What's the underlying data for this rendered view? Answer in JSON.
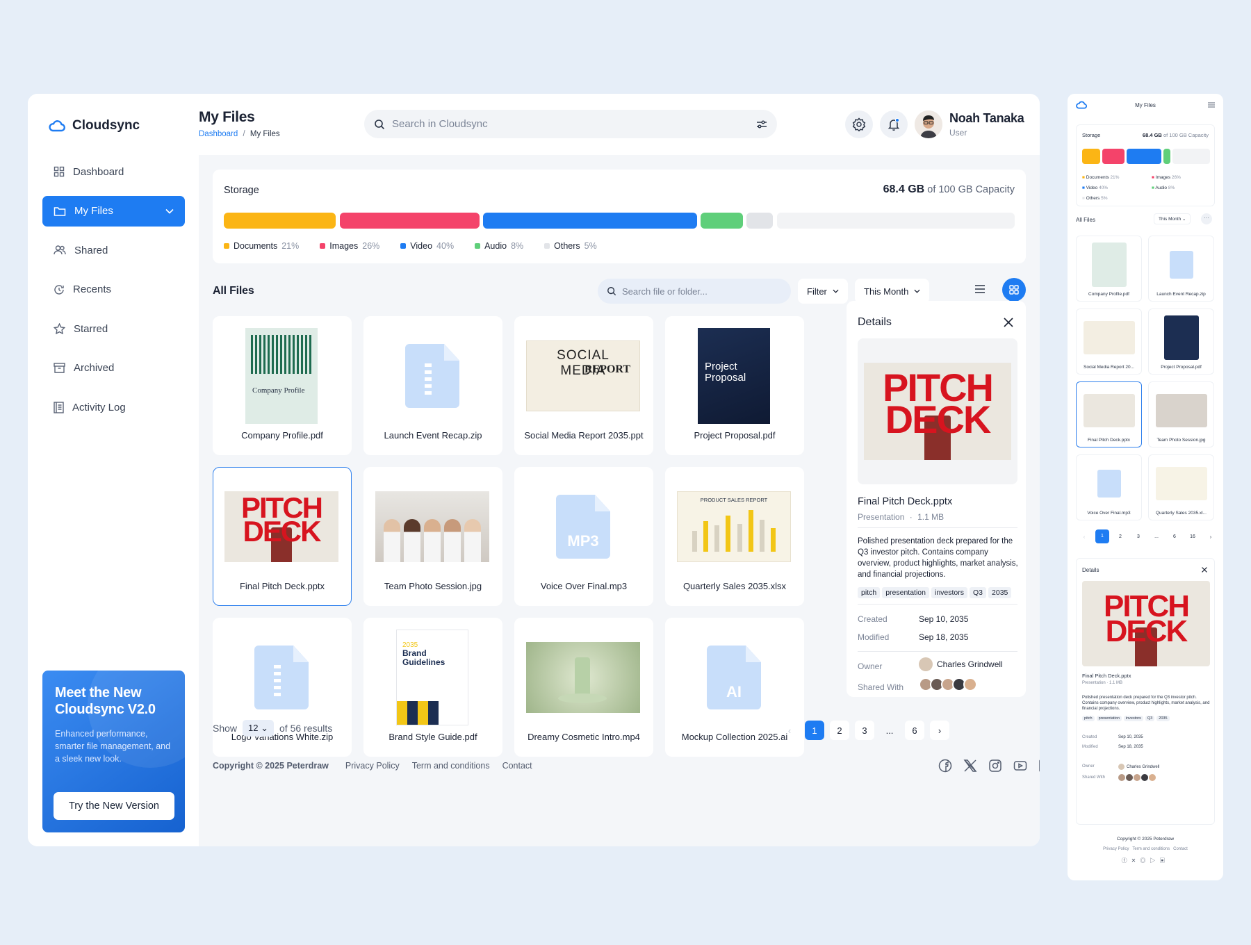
{
  "app": {
    "name": "Cloudsync"
  },
  "sidebar": {
    "items": [
      {
        "label": "Dashboard",
        "icon": "grid-icon"
      },
      {
        "label": "My Files",
        "icon": "folder-icon",
        "active": true
      },
      {
        "label": "Shared",
        "icon": "users-icon"
      },
      {
        "label": "Recents",
        "icon": "clock-icon"
      },
      {
        "label": "Starred",
        "icon": "star-icon"
      },
      {
        "label": "Archived",
        "icon": "archive-icon"
      },
      {
        "label": "Activity Log",
        "icon": "log-icon"
      }
    ],
    "promo": {
      "title": "Meet the New Cloudsync V2.0",
      "text": "Enhanced performance, smarter file management, and a sleek new look.",
      "button": "Try the New Version"
    }
  },
  "header": {
    "title": "My Files",
    "breadcrumb_root": "Dashboard",
    "breadcrumb_sep": "/",
    "breadcrumb_current": "My Files",
    "search_placeholder": "Search in Cloudsync",
    "user_name": "Noah Tanaka",
    "user_role": "User"
  },
  "storage": {
    "title": "Storage",
    "used": "68.4 GB",
    "capacity": "of 100 GB Capacity",
    "categories": [
      {
        "label": "Documents",
        "percent": "21%",
        "color": "#fbb515"
      },
      {
        "label": "Images",
        "percent": "26%",
        "color": "#f4436a"
      },
      {
        "label": "Video",
        "percent": "40%",
        "color": "#1e7cf2"
      },
      {
        "label": "Audio",
        "percent": "8%",
        "color": "#5fcf7a"
      },
      {
        "label": "Others",
        "percent": "5%",
        "color": "#e2e4e8"
      }
    ]
  },
  "files": {
    "title": "All Files",
    "search_placeholder": "Search file or folder...",
    "filter_label": "Filter",
    "period_label": "This Month",
    "items": [
      {
        "name": "Company Profile.pdf",
        "kind": "doc-company",
        "thumb_text": "Company Profile"
      },
      {
        "name": "Launch Event Recap.zip",
        "kind": "zip"
      },
      {
        "name": "Social Media Report 2035.ppt",
        "kind": "social",
        "thumb_text": "SOCIAL MEDIA",
        "thumb_text2": "REPORT"
      },
      {
        "name": "Project Proposal.pdf",
        "kind": "proposal",
        "thumb_text": "Project Proposal"
      },
      {
        "name": "Final Pitch Deck.pptx",
        "kind": "pitch",
        "selected": true,
        "thumb_text": "PITCH",
        "thumb_text2": "DECK"
      },
      {
        "name": "Team Photo Session.jpg",
        "kind": "team"
      },
      {
        "name": "Voice Over Final.mp3",
        "kind": "mp3",
        "thumb_text": "MP3"
      },
      {
        "name": "Quarterly Sales 2035.xlsx",
        "kind": "sales",
        "thumb_text": "PRODUCT SALES REPORT"
      },
      {
        "name": "Logo Variations White.zip",
        "kind": "zip"
      },
      {
        "name": "Brand Style Guide.pdf",
        "kind": "brand",
        "thumb_text": "Brand Guidelines",
        "thumb_text2": "2035"
      },
      {
        "name": "Dreamy Cosmetic Intro.mp4",
        "kind": "cosmetic"
      },
      {
        "name": "Mockup Collection 2025.ai",
        "kind": "ai",
        "thumb_text": "AI"
      }
    ]
  },
  "details": {
    "title": "Details",
    "file_name": "Final Pitch Deck.pptx",
    "file_type": "Presentation",
    "file_sep": "·",
    "file_size": "1.1 MB",
    "description": "Polished presentation deck prepared for the Q3 investor pitch. Contains company overview, product highlights, market analysis, and financial projections.",
    "tags": [
      "pitch",
      "presentation",
      "investors",
      "Q3",
      "2035"
    ],
    "created_label": "Created",
    "created": "Sep 10, 2035",
    "modified_label": "Modified",
    "modified": "Sep 18, 2035",
    "owner_label": "Owner",
    "owner": "Charles Grindwell",
    "shared_label": "Shared With",
    "shared_count": 5
  },
  "pagination": {
    "show_label": "Show",
    "per_page": "12",
    "results": "of 56 results",
    "pages": [
      "1",
      "2",
      "3",
      "...",
      "6"
    ],
    "current": "1"
  },
  "footer": {
    "copyright": "Copyright © 2025 Peterdraw",
    "links": [
      "Privacy Policy",
      "Term and conditions",
      "Contact"
    ],
    "socials": [
      "facebook-icon",
      "x-icon",
      "instagram-icon",
      "youtube-icon",
      "linkedin-icon"
    ]
  },
  "mini": {
    "title": "My Files",
    "files_title": "All Files",
    "period": "This Month",
    "pages": [
      "1",
      "2",
      "3",
      "...",
      "6",
      "16"
    ],
    "copyright": "Copyright © 2025 Peterdraw",
    "legend": [
      {
        "label": "Documents",
        "percent": "21%",
        "color": "#fbb515"
      },
      {
        "label": "Images",
        "percent": "26%",
        "color": "#f4436a"
      },
      {
        "label": "Video",
        "percent": "40%",
        "color": "#1e7cf2"
      },
      {
        "label": "Audio",
        "percent": "8%",
        "color": "#5fcf7a"
      },
      {
        "label": "Others",
        "percent": "5%",
        "color": "#e2e4e8"
      }
    ],
    "file_names": [
      "Company Profile.pdf",
      "Launch Event Recap.zip",
      "Social Media Report 20...",
      "Project Proposal.pdf",
      "Final Pitch Deck.pptx",
      "Team Photo Session.jpg",
      "Voice Over Final.mp3",
      "Quarterly Sales 2035.xl..."
    ]
  },
  "colors": {
    "accent": "#1e7cf2",
    "bg": "#e6eef8"
  }
}
